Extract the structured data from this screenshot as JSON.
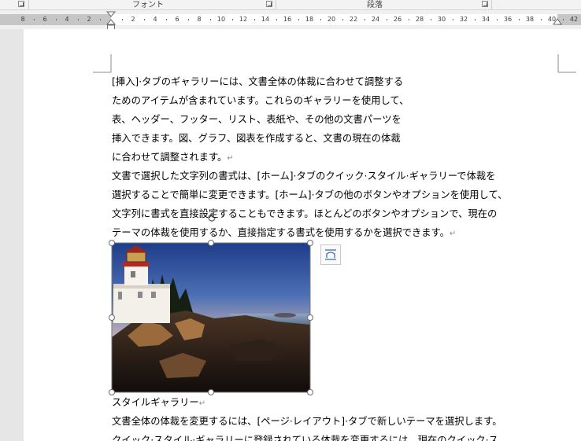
{
  "ribbon": {
    "groups": [
      {
        "label": "フォント"
      },
      {
        "label": "段落"
      }
    ]
  },
  "ruler": {
    "left_margin_numbers": [
      "8",
      "6",
      "4",
      "2"
    ],
    "body_numbers": [
      "2",
      "4",
      "6",
      "8",
      "10",
      "12",
      "14",
      "16",
      "18",
      "20",
      "22",
      "24",
      "26",
      "28",
      "30",
      "32",
      "34",
      "36",
      "38",
      "40"
    ],
    "right_margin_numbers": [
      "42"
    ]
  },
  "document": {
    "paragraph1_lines": [
      "[挿入]·タブのギャラリーには、文書全体の体裁に合わせて調整する",
      "ためのアイテムが含まれています。これらのギャラリーを使用して、",
      "表、ヘッダー、フッター、リスト、表紙や、その他の文書パーツを",
      "挿入できます。図、グラフ、図表を作成すると、文書の現在の体裁",
      "に合わせて調整されます。"
    ],
    "paragraph2_lines": [
      "文書で選択した文字列の書式は、[ホーム]·タブのクイック·スタイル·ギャラリーで体裁を",
      "選択することで簡単に変更できます。[ホーム]·タブの他のボタンやオプションを使用して、",
      "文字列に書式を直接設定することもできます。ほとんどのボタンやオプションで、現在の",
      "テーマの体裁を使用するか、直接指定する書式を使用するかを選択できます。"
    ],
    "picture_alt": "灯台の写真",
    "heading": "スタイルギャラリー",
    "paragraph3_lines": [
      "文書全体の体裁を変更するには、[ページ·レイアウト]·タブで新しいテーマを選択します。",
      "クイック·スタイル·ギャラリーに登録されている体裁を変更するには、現在のクイック·ス"
    ],
    "paragraph_mark": "↵"
  },
  "icons": {
    "layout_options": "layout-options-icon",
    "rotate": "rotate-handle-icon",
    "launcher": "dialog-launcher-icon"
  },
  "colors": {
    "ruler_margin": "#c6c6c6",
    "page": "#ffffff",
    "workspace": "#e6e6e6"
  }
}
